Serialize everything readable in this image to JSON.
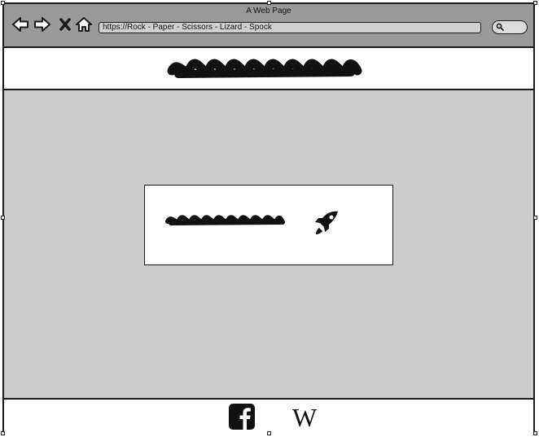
{
  "browser": {
    "window_title": "A Web Page",
    "url": "https://Rock - Paper - Scissors - Lizard - Spock",
    "icons": [
      "back-arrow-icon",
      "forward-arrow-icon",
      "close-x-icon",
      "home-icon",
      "search-icon"
    ]
  },
  "header": {
    "logo": "scribble-heading-placeholder"
  },
  "main": {
    "card": {
      "text": "scribble-text-placeholder",
      "icon": "rocket-icon"
    }
  },
  "footer": {
    "links": [
      "facebook-icon",
      "wikipedia-icon"
    ],
    "wikipedia_glyph": "W"
  },
  "colors": {
    "browser_bar": "#9a9a9a",
    "content_bg": "#cccccc",
    "stroke": "#1a1a1a"
  }
}
